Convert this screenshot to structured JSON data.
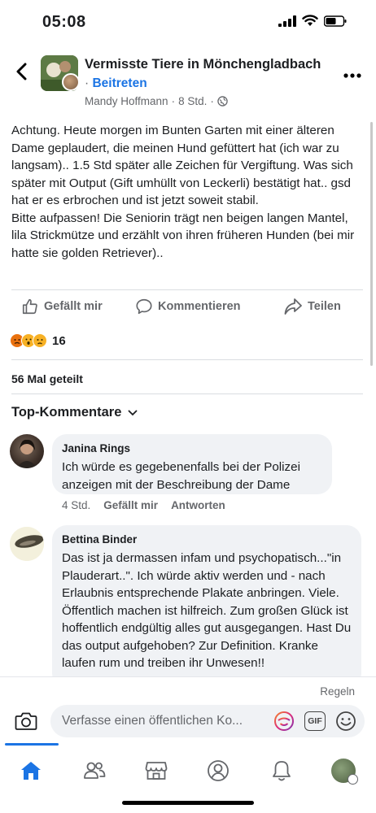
{
  "status": {
    "time": "05:08",
    "battery_label": "battery-icon"
  },
  "header": {
    "group_name": "Vermisste Tiere in Mönchengladbach",
    "join_dot": "·",
    "join_label": "Beitreten",
    "author": "Mandy Hoffmann",
    "time": "8 Std.",
    "dot": "·",
    "privacy_icon": "globe-icon"
  },
  "post": {
    "text": "Achtung. Heute morgen im Bunten Garten mit einer älteren Dame geplaudert, die meinen Hund gefüttert hat (ich war zu langsam).. 1.5 Std später alle Zeichen für Vergiftung. Was sich später mit Output (Gift umhüllt von Leckerli) bestätigt hat.. gsd hat er es erbrochen und ist jetzt soweit stabil.\nBitte aufpassen! Die Seniorin trägt nen beigen langen Mantel, lila Strickmütze und erzählt von ihren früheren Hunden (bei mir hatte sie golden Retriever).."
  },
  "actions": {
    "like": "Gefällt mir",
    "comment": "Kommentieren",
    "share": "Teilen"
  },
  "reactions": {
    "icons": [
      "angry-icon",
      "wow-icon",
      "sad-icon"
    ],
    "count": "16"
  },
  "shares": "56 Mal geteilt",
  "top_comments_label": "Top-Kommentare",
  "comments": [
    {
      "name": "Janina Rings",
      "text": "Ich würde es gegebenenfalls bei der Polizei anzeigen mit der Beschreibung der Dame",
      "time": "4 Std.",
      "like": "Gefällt mir",
      "reply": "Antworten"
    },
    {
      "name": "Bettina Binder",
      "text": "Das ist ja dermassen infam und psychopatisch...\"in Plauderart..\". Ich würde aktiv werden und - nach Erlaubnis entsprechende Plakate anbringen. Viele. Öffentlich machen ist hilfreich. Zum großen Glück ist hoffentlich endgültig alles gut ausgegangen. Hast Du das output aufgehoben? Zur Definition. Kranke laufen rum und treiben ihr Unwesen!!"
    }
  ],
  "composer": {
    "rules": "Regeln",
    "placeholder": "Verfasse einen öffentlichen Ko...",
    "gif_label": "GIF"
  },
  "tabs": [
    "home-icon",
    "friends-icon",
    "marketplace-icon",
    "profile-icon",
    "notifications-icon",
    "menu-avatar"
  ],
  "colors": {
    "accent": "#1b74e4",
    "text": "#1c1e21",
    "secondary": "#65676b",
    "bubble": "#f0f2f5"
  }
}
